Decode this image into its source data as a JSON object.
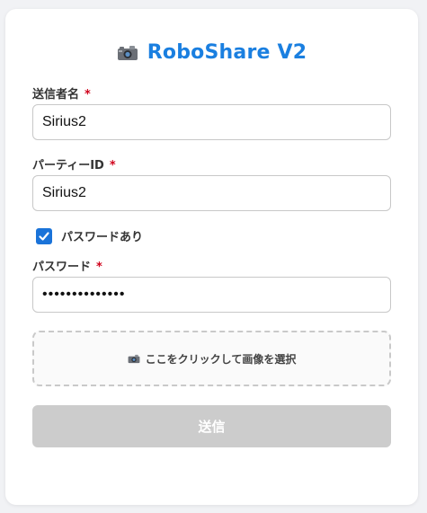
{
  "header": {
    "title": "RoboShare V2",
    "icon": "camera-icon"
  },
  "form": {
    "sender_name": {
      "label": "送信者名",
      "required_mark": "*",
      "value": "Sirius2"
    },
    "party_id": {
      "label": "パーティーID",
      "required_mark": "*",
      "value": "Sirius2"
    },
    "password_toggle": {
      "label": "パスワードあり",
      "checked": true
    },
    "password": {
      "label": "パスワード",
      "required_mark": "*",
      "value": "••••••••••••••"
    },
    "image_upload": {
      "label": "ここをクリックして画像を選択",
      "icon": "camera-icon"
    },
    "submit_label": "送信"
  },
  "colors": {
    "accent": "#1a7fe0",
    "required": "#d0021b",
    "checkbox": "#1a73d9",
    "submit_disabled": "#cccccc"
  }
}
